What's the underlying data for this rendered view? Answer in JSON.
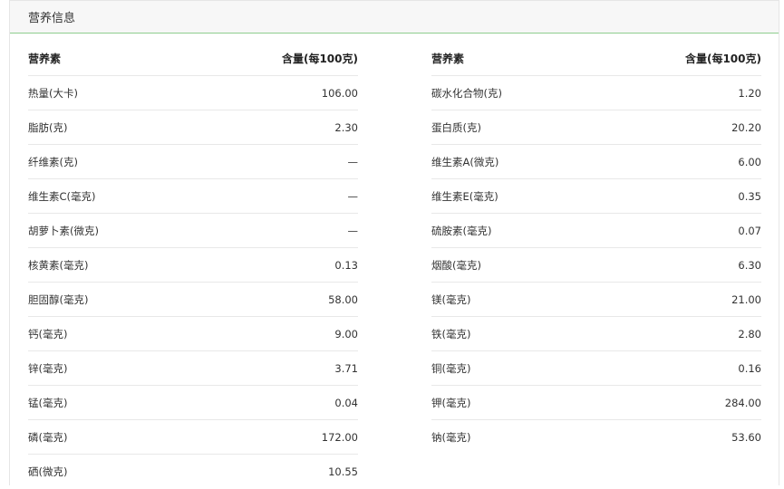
{
  "panel": {
    "title": "营养信息"
  },
  "columns": {
    "nutrient": "营养素",
    "amount": "含量(每100克)"
  },
  "left_rows": [
    {
      "name": "热量(大卡)",
      "value": "106.00"
    },
    {
      "name": "脂肪(克)",
      "value": "2.30"
    },
    {
      "name": "纤维素(克)",
      "value": "—"
    },
    {
      "name": "维生素C(毫克)",
      "value": "—"
    },
    {
      "name": "胡萝卜素(微克)",
      "value": "—"
    },
    {
      "name": "核黄素(毫克)",
      "value": "0.13"
    },
    {
      "name": "胆固醇(毫克)",
      "value": "58.00"
    },
    {
      "name": "钙(毫克)",
      "value": "9.00"
    },
    {
      "name": "锌(毫克)",
      "value": "3.71"
    },
    {
      "name": "锰(毫克)",
      "value": "0.04"
    },
    {
      "name": "磷(毫克)",
      "value": "172.00"
    },
    {
      "name": "硒(微克)",
      "value": "10.55"
    }
  ],
  "right_rows": [
    {
      "name": "碳水化合物(克)",
      "value": "1.20"
    },
    {
      "name": "蛋白质(克)",
      "value": "20.20"
    },
    {
      "name": "维生素A(微克)",
      "value": "6.00"
    },
    {
      "name": "维生素E(毫克)",
      "value": "0.35"
    },
    {
      "name": "硫胺素(毫克)",
      "value": "0.07"
    },
    {
      "name": "烟酸(毫克)",
      "value": "6.30"
    },
    {
      "name": "镁(毫克)",
      "value": "21.00"
    },
    {
      "name": "铁(毫克)",
      "value": "2.80"
    },
    {
      "name": "铜(毫克)",
      "value": "0.16"
    },
    {
      "name": "钾(毫克)",
      "value": "284.00"
    },
    {
      "name": "钠(毫克)",
      "value": "53.60"
    }
  ]
}
